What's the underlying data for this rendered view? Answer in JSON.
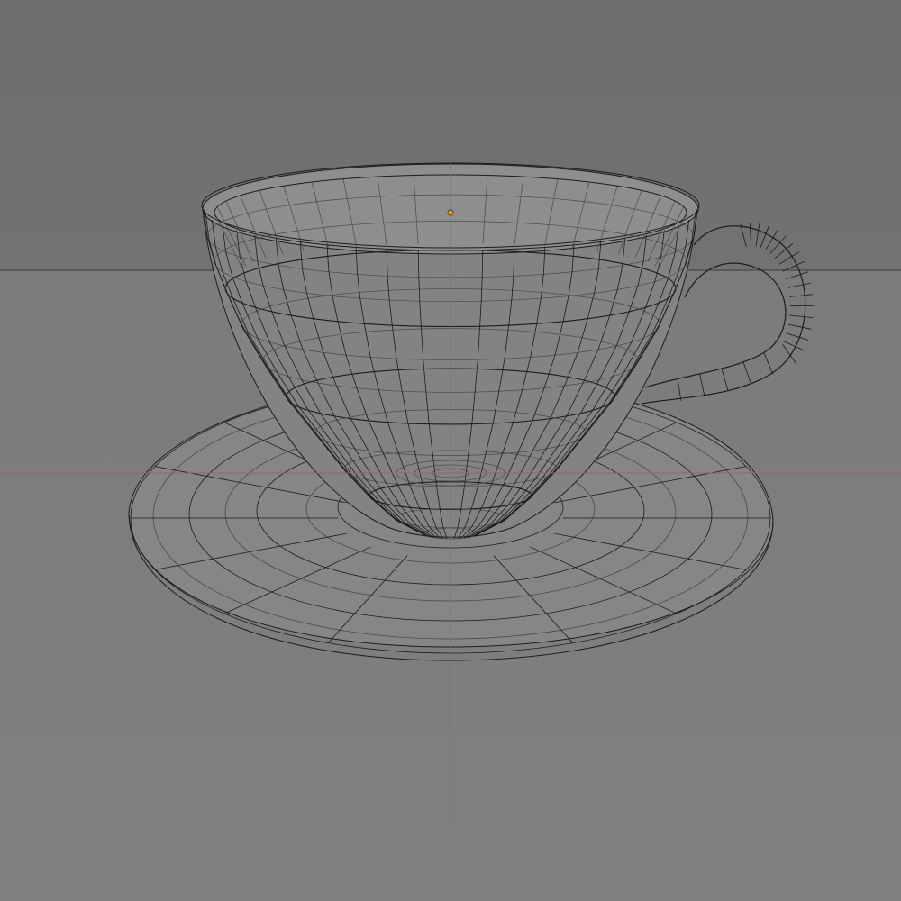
{
  "viewport": {
    "view": "3d-viewport",
    "shading": "wireframe",
    "objects": [
      "cup",
      "saucer"
    ]
  },
  "colors": {
    "background_upper": "#6e6e6e",
    "background_lower": "#808080",
    "horizon_line": "#3a3a3a",
    "x_axis": "#b05a5a",
    "y_axis": "#4f7f8f",
    "wire": "#1c1c1c",
    "wire_faint": "#4a4a4a",
    "surface_fill": "#8a8a8a",
    "origin_point": "#f0a020"
  },
  "icons": {
    "origin": "origin-dot-icon"
  }
}
